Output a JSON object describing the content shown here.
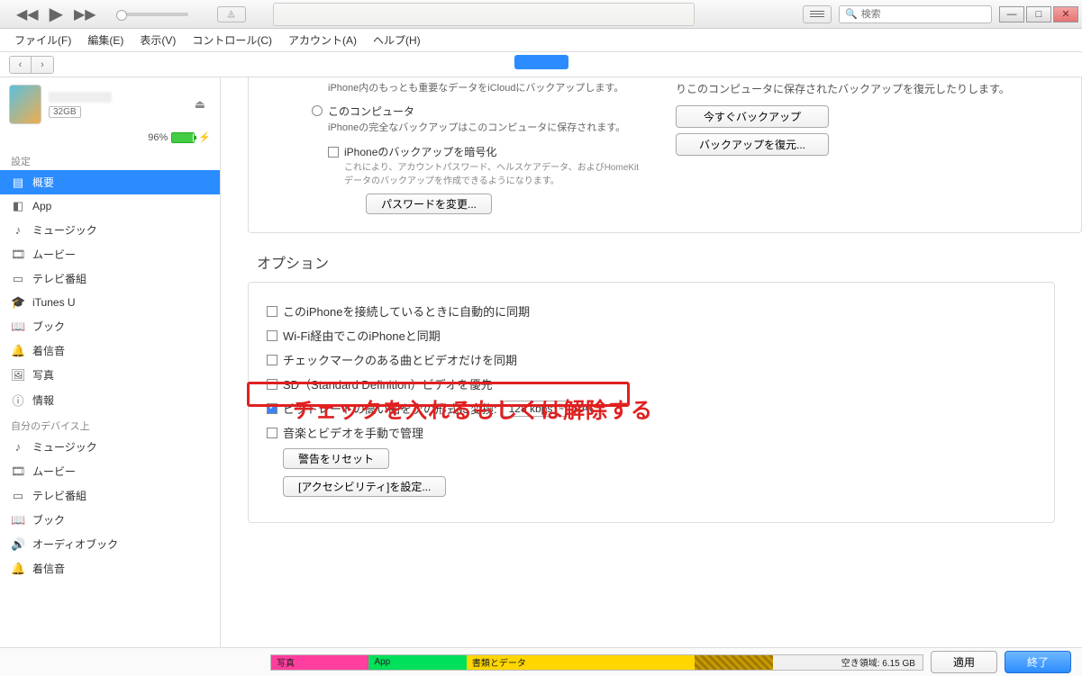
{
  "titlebar": {
    "search_placeholder": "検索"
  },
  "menubar": {
    "file": "ファイル(F)",
    "edit": "編集(E)",
    "view": "表示(V)",
    "control": "コントロール(C)",
    "account": "アカウント(A)",
    "help": "ヘルプ(H)"
  },
  "device": {
    "capacity": "32GB",
    "battery_pct": "96%"
  },
  "sidebar": {
    "settings_heading": "設定",
    "summary": "概要",
    "app": "App",
    "music": "ミュージック",
    "movie": "ムービー",
    "tv": "テレビ番組",
    "itunesu": "iTunes U",
    "book": "ブック",
    "ringtone1": "着信音",
    "photo": "写真",
    "info": "情報",
    "ondevice_heading": "自分のデバイス上",
    "d_music": "ミュージック",
    "d_movie": "ムービー",
    "d_tv": "テレビ番組",
    "d_book": "ブック",
    "d_audiobook": "オーディオブック",
    "d_ringtone": "着信音"
  },
  "backup": {
    "icloud_desc": "iPhone内のもっとも重要なデータをiCloudにバックアップします。",
    "this_pc": "このコンピュータ",
    "this_pc_desc": "iPhoneの完全なバックアップはこのコンピュータに保存されます。",
    "encrypt": "iPhoneのバックアップを暗号化",
    "encrypt_desc": "これにより、アカウントパスワード、ヘルスケアデータ、およびHomeKitデータのバックアップを作成できるようになります。",
    "change_pw": "パスワードを変更...",
    "right_desc": "りこのコンピュータに保存されたバックアップを復元したりします。",
    "backup_now": "今すぐバックアップ",
    "restore": "バックアップを復元..."
  },
  "options": {
    "title": "オプション",
    "auto_sync": "このiPhoneを接続しているときに自動的に同期",
    "wifi_sync": "Wi-Fi経由でこのiPhoneと同期",
    "checked_only": "チェックマークのある曲とビデオだけを同期",
    "sd_prefer": "SD（Standard Definition）ビデオを優先",
    "bitrate_convert": "ビットレートの高い曲を次の形式に変換:",
    "bitrate_value": "128 kbps",
    "bitrate_codec": "AAC",
    "manual": "音楽とビデオを手動で管理",
    "reset_warn": "警告をリセット",
    "accessibility": "[アクセシビリティ]を設定..."
  },
  "annotation": "チェックを入れるもしくは解除する",
  "bottom": {
    "photo": "写真",
    "app": "App",
    "doc": "書類とデータ",
    "free": "空き領域: 6.15 GB",
    "apply": "適用",
    "done": "終了"
  }
}
